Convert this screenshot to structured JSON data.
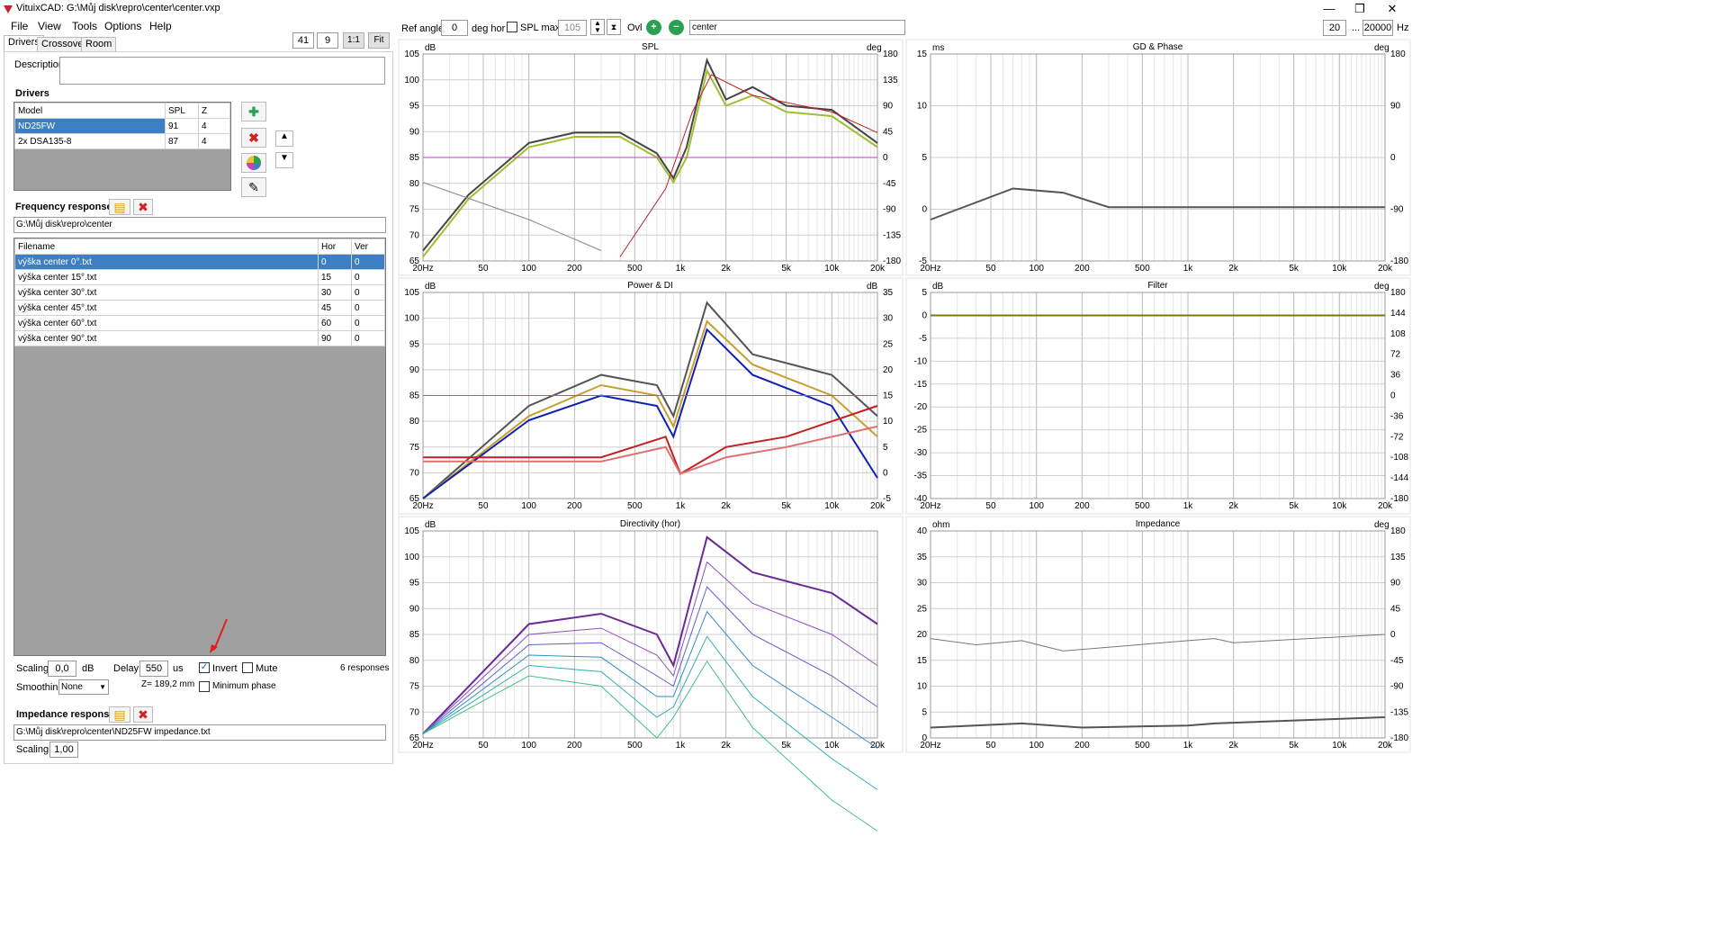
{
  "window": {
    "title": "VituixCAD: G:\\Můj disk\\repro\\center\\center.vxp",
    "min": "—",
    "max": "❐",
    "close": "✕"
  },
  "menu": [
    "File",
    "View",
    "Tools",
    "Options",
    "Help"
  ],
  "tabs": [
    "Drivers",
    "Crossover",
    "Room"
  ],
  "top_controls": {
    "v1": "41",
    "v2": "9",
    "ratio": "1:1",
    "fit": "Fit"
  },
  "description": {
    "label": "Description",
    "value": ""
  },
  "drivers": {
    "heading": "Drivers",
    "columns": [
      "Model",
      "SPL",
      "Z"
    ],
    "rows": [
      {
        "model": "ND25FW",
        "spl": "91",
        "z": "4"
      },
      {
        "model": "2x DSA135-8",
        "spl": "87",
        "z": "4"
      }
    ]
  },
  "freq": {
    "heading": "Frequency responses",
    "path": "G:\\Můj disk\\repro\\center",
    "columns": [
      "Filename",
      "Hor",
      "Ver"
    ],
    "rows": [
      {
        "file": "výška center 0°.txt",
        "hor": "0",
        "ver": "0"
      },
      {
        "file": "výška center 15°.txt",
        "hor": "15",
        "ver": "0"
      },
      {
        "file": "výška center 30°.txt",
        "hor": "30",
        "ver": "0"
      },
      {
        "file": "výška center 45°.txt",
        "hor": "45",
        "ver": "0"
      },
      {
        "file": "výška center 60°.txt",
        "hor": "60",
        "ver": "0"
      },
      {
        "file": "výška center 90°.txt",
        "hor": "90",
        "ver": "0"
      }
    ]
  },
  "params": {
    "scaling_label": "Scaling",
    "scaling": "0,0",
    "db": "dB",
    "delay_label": "Delay",
    "delay": "550",
    "us": "us",
    "invert": "Invert",
    "mute": "Mute",
    "responses": "6 responses",
    "smoothing_label": "Smoothing",
    "smoothing": "None",
    "z": "Z= 189,2 mm",
    "minphase": "Minimum phase"
  },
  "impedance": {
    "heading": "Impedance response",
    "path": "G:\\Můj disk\\repro\\center\\ND25FW impedance.txt",
    "scaling_label": "Scaling",
    "scaling": "1,00"
  },
  "toolbar": {
    "ref_angle_label": "Ref angle",
    "ref_angle": "0",
    "deg_hor": "deg hor",
    "spl_max": "SPL max",
    "spl_max_val": "105",
    "ovl": "Ovl",
    "ovl_val": "center",
    "fmin": "20",
    "dots": "...",
    "fmax": "20000",
    "hz": "Hz"
  },
  "freq_ticks": [
    "20Hz",
    "50",
    "100",
    "200",
    "500",
    "1k",
    "2k",
    "5k",
    "10k",
    "20k"
  ],
  "charts": {
    "spl": {
      "title": "SPL",
      "yl": "dB",
      "yr": "deg",
      "left": [
        "105",
        "100",
        "95",
        "90",
        "85",
        "80",
        "75",
        "70",
        "65"
      ],
      "right": [
        "180",
        "135",
        "90",
        "45",
        "0",
        "-45",
        "-90",
        "-135",
        "-180"
      ]
    },
    "gd": {
      "title": "GD & Phase",
      "yl": "ms",
      "yr": "deg",
      "left": [
        "15",
        "10",
        "5",
        "0",
        "-5"
      ],
      "right": [
        "180",
        "90",
        "0",
        "-90",
        "-180"
      ]
    },
    "power": {
      "title": "Power & DI",
      "yl": "dB",
      "yr": "dB",
      "left": [
        "105",
        "100",
        "95",
        "90",
        "85",
        "80",
        "75",
        "70",
        "65"
      ],
      "right": [
        "35",
        "30",
        "25",
        "20",
        "15",
        "10",
        "5",
        "0",
        "-5"
      ]
    },
    "filter": {
      "title": "Filter",
      "yl": "dB",
      "yr": "deg",
      "left": [
        "5",
        "0",
        "-5",
        "-10",
        "-15",
        "-20",
        "-25",
        "-30",
        "-35",
        "-40"
      ],
      "right": [
        "180",
        "144",
        "108",
        "72",
        "36",
        "0",
        "-36",
        "-72",
        "-108",
        "-144",
        "-180"
      ]
    },
    "dir": {
      "title": "Directivity (hor)",
      "yl": "dB",
      "yr": "",
      "left": [
        "105",
        "100",
        "95",
        "90",
        "85",
        "80",
        "75",
        "70",
        "65"
      ],
      "right": []
    },
    "imp": {
      "title": "Impedance",
      "yl": "ohm",
      "yr": "deg",
      "left": [
        "40",
        "35",
        "30",
        "25",
        "20",
        "15",
        "10",
        "5",
        "0"
      ],
      "right": [
        "180",
        "135",
        "90",
        "45",
        "0",
        "-45",
        "-90",
        "-135",
        "-180"
      ]
    }
  },
  "colors": {
    "selection": "#3c7fc2",
    "purple_ref": "#c83cc8",
    "dark": "#5a5a5a"
  }
}
